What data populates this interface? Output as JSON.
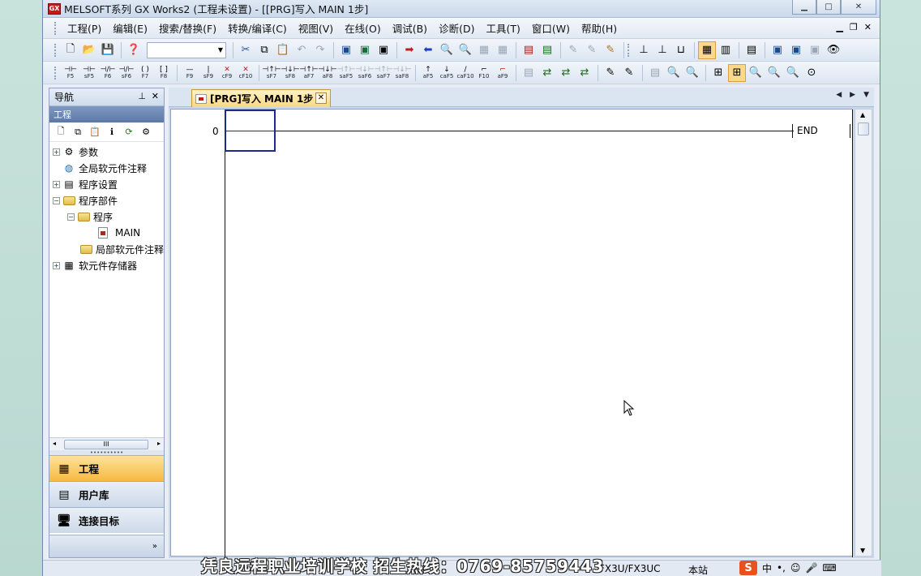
{
  "window": {
    "title": "MELSOFT系列 GX Works2 (工程未设置) - [[PRG]写入 MAIN 1步]",
    "icon_text": "GX"
  },
  "menu": {
    "items": [
      "工程(P)",
      "编辑(E)",
      "搜索/替换(F)",
      "转换/编译(C)",
      "视图(V)",
      "在线(O)",
      "调试(B)",
      "诊断(D)",
      "工具(T)",
      "窗口(W)",
      "帮助(H)"
    ]
  },
  "toolbar2": {
    "keys": [
      "F5",
      "sF5",
      "F6",
      "sF6",
      "F7",
      "F8",
      "F9",
      "sF9",
      "cF9",
      "cF10",
      "sF7",
      "sF8",
      "aF7",
      "aF8",
      "saF5",
      "saF6",
      "saF7",
      "saF8",
      "aF5",
      "caF5",
      "caF10",
      "F10",
      "aF9"
    ]
  },
  "navigator": {
    "title": "导航",
    "section": "工程",
    "tree": [
      {
        "label": "参数",
        "expander": "+"
      },
      {
        "label": "全局软元件注释",
        "expander": ""
      },
      {
        "label": "程序设置",
        "expander": "+"
      },
      {
        "label": "程序部件",
        "expander": "−"
      },
      {
        "label": "程序",
        "expander": "−"
      },
      {
        "label": "MAIN",
        "expander": ""
      },
      {
        "label": "局部软元件注释",
        "expander": ""
      },
      {
        "label": "软元件存储器",
        "expander": "+"
      }
    ],
    "buttons": [
      "工程",
      "用户库",
      "连接目标"
    ],
    "more": "»"
  },
  "document": {
    "tab_label": "[PRG]写入 MAIN 1步",
    "step_number": "0",
    "end_label": "END"
  },
  "status": {
    "plc_type": "FX3U/FX3UC",
    "station": "本站",
    "watermark": "凭良远程职业培训学校 招生热线：0769-85759443",
    "ime_logo": "S",
    "ime_mode": "中"
  }
}
